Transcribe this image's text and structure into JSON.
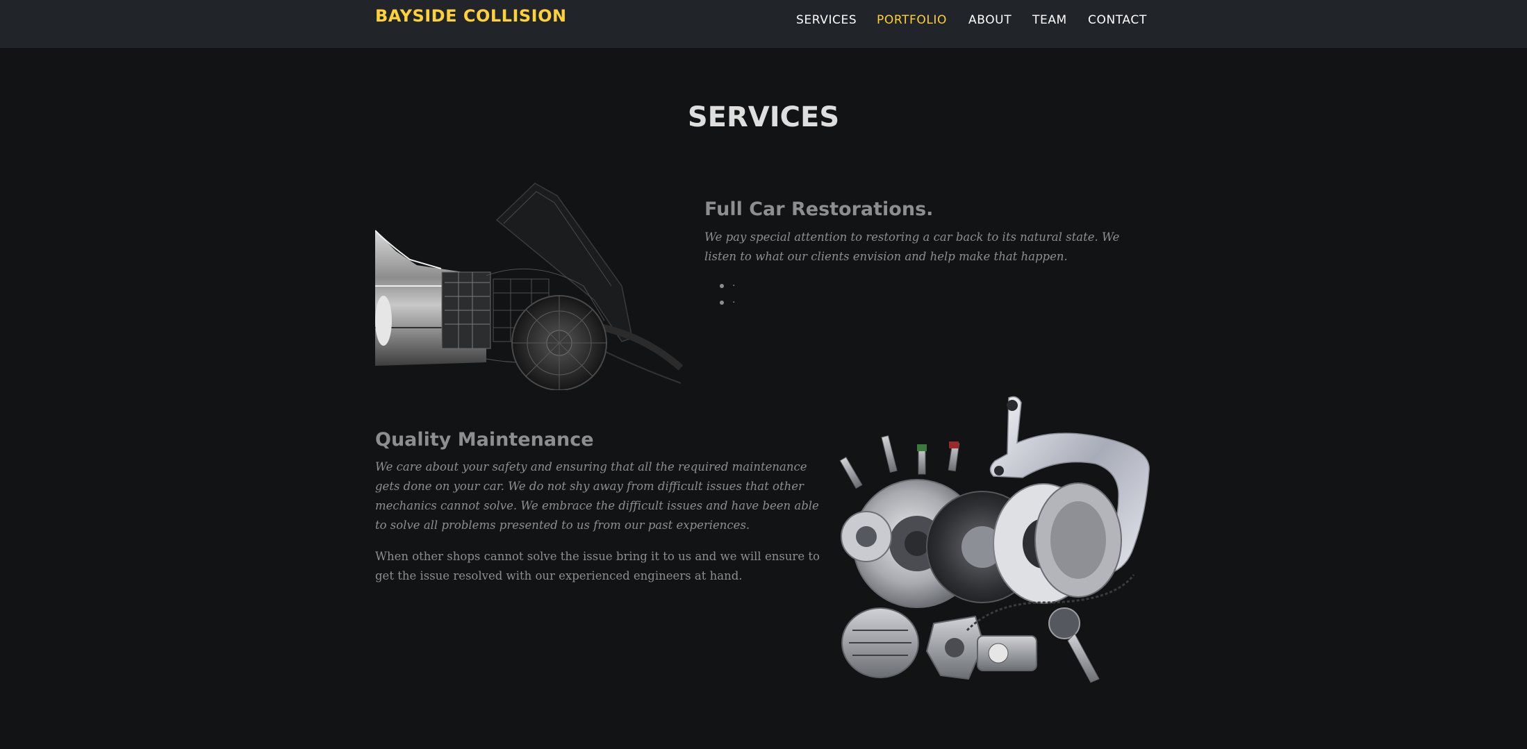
{
  "navbar": {
    "brand": "BAYSIDE COLLISION",
    "items": [
      {
        "label": "SERVICES",
        "active": false
      },
      {
        "label": "PORTFOLIO",
        "active": true
      },
      {
        "label": "ABOUT",
        "active": false
      },
      {
        "label": "TEAM",
        "active": false
      },
      {
        "label": "CONTACT",
        "active": false
      }
    ]
  },
  "colors": {
    "accent": "#fed136",
    "page_background": "#121314",
    "navbar_background": "#212429",
    "muted_text": "#8e8e8e"
  },
  "services": {
    "title": "SERVICES",
    "restoration": {
      "heading": "Full Car Restorations.",
      "text": "We pay special attention to restoring a car back to its natural state. We listen to what our clients envision and help make that happen.",
      "bullets": [
        ".",
        "."
      ],
      "image": "car-blueprint-image"
    },
    "maintenance": {
      "heading": "Quality Maintenance",
      "text": "We care about your safety and ensuring that all the required maintenance gets done on your car. We do not shy away from difficult issues that other mechanics cannot solve. We embrace the difficult issues and have been able to solve all problems presented to us from our past experiences.",
      "text2": "When other shops cannot solve the issue bring it to us and we will ensure to get the issue resolved with our experienced engineers at hand.",
      "image": "car-parts-image"
    }
  }
}
